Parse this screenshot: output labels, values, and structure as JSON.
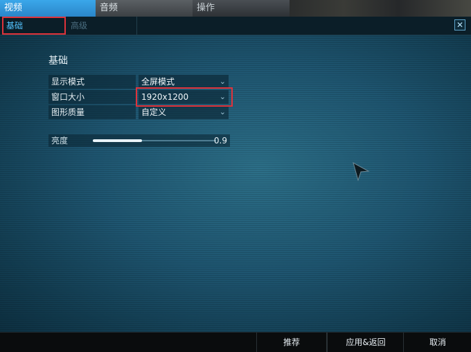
{
  "tabs": {
    "video": "视频",
    "audio": "音频",
    "control": "操作"
  },
  "subtabs": {
    "basic": "基础",
    "advanced": "高级"
  },
  "close_glyph": "✕",
  "section_title": "基础",
  "options": [
    {
      "label": "显示模式",
      "value": "全屏模式"
    },
    {
      "label": "窗口大小",
      "value": "1920x1200"
    },
    {
      "label": "图形质量",
      "value": "自定义"
    }
  ],
  "brightness": {
    "label": "亮度",
    "value": 0.9,
    "value_text": "0.9"
  },
  "buttons": {
    "recommend": "推荐",
    "apply": "应用&返回",
    "cancel": "取消"
  },
  "colors": {
    "active_tab": "#3aa7ea",
    "highlight": "#e0333b",
    "panel": "#1e5570"
  }
}
